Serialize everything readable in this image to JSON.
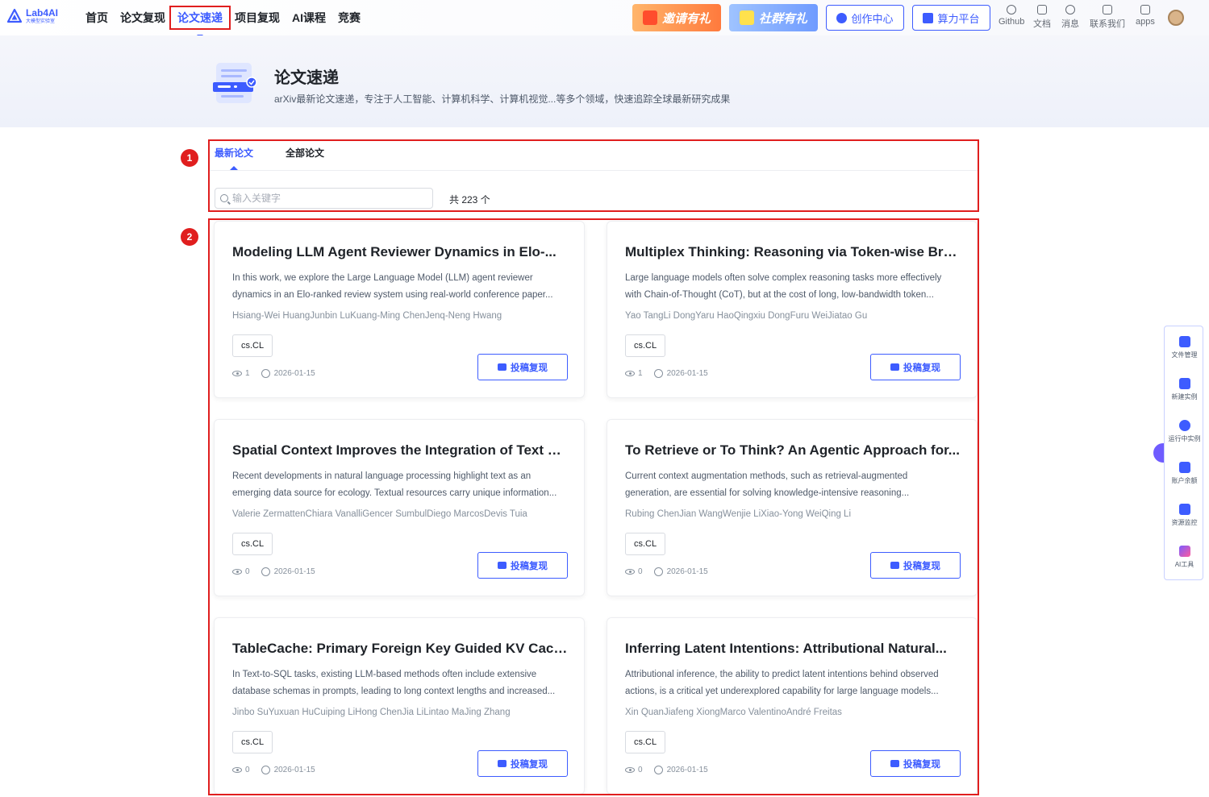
{
  "header": {
    "logo_title": "Lab4AI",
    "logo_subtitle": "大模型实验室",
    "nav": [
      {
        "label": "首页"
      },
      {
        "label": "论文复现"
      },
      {
        "label": "论文速递"
      },
      {
        "label": "项目复现"
      },
      {
        "label": "AI课程"
      },
      {
        "label": "竞赛"
      }
    ],
    "active_nav": "论文速递",
    "promo_invite": "邀请有礼",
    "promo_group": "社群有礼",
    "create_center": "创作中心",
    "compute_platform": "算力平台",
    "utils": [
      {
        "label": "Github",
        "icon": "github-icon"
      },
      {
        "label": "文档",
        "icon": "document-icon"
      },
      {
        "label": "消息",
        "icon": "bell-icon"
      },
      {
        "label": "联系我们",
        "icon": "chat-icon"
      },
      {
        "label": "apps",
        "icon": "apps-grid-icon"
      }
    ]
  },
  "hero": {
    "title": "论文速递",
    "description": "arXiv最新论文速递，专注于人工智能、计算机科学、计算机视觉...等多个领域，快速追踪全球最新研究成果"
  },
  "tabs": {
    "items": [
      {
        "label": "最新论文"
      },
      {
        "label": "全部论文"
      }
    ],
    "active": "最新论文"
  },
  "search": {
    "placeholder": "输入关键字",
    "value": ""
  },
  "total_label": "共 223 个",
  "markers": [
    "1",
    "2"
  ],
  "submit_label": "投稿复现",
  "papers": [
    {
      "title": "Modeling LLM Agent Reviewer Dynamics in Elo-...",
      "abstract": "In this work, we explore the Large Language Model (LLM) agent reviewer dynamics in an Elo-ranked review system using real-world conference paper...",
      "authors": "Hsiang-Wei HuangJunbin LuKuang-Ming ChenJenq-Neng Hwang",
      "tag": "cs.CL",
      "views": "1",
      "date": "2026-01-15"
    },
    {
      "title": "Multiplex Thinking: Reasoning via Token-wise Branc...",
      "abstract": "Large language models often solve complex reasoning tasks more effectively with Chain-of-Thought (CoT), but at the cost of long, low-bandwidth token...",
      "authors": "Yao TangLi DongYaru HaoQingxiu DongFuru WeiJiatao Gu",
      "tag": "cs.CL",
      "views": "1",
      "date": "2026-01-15"
    },
    {
      "title": "Spatial Context Improves the Integration of Text wit...",
      "abstract": "Recent developments in natural language processing highlight text as an emerging data source for ecology. Textual resources carry unique information...",
      "authors": "Valerie ZermattenChiara VanalliGencer SumbulDiego MarcosDevis Tuia",
      "tag": "cs.CL",
      "views": "0",
      "date": "2026-01-15"
    },
    {
      "title": "To Retrieve or To Think? An Agentic Approach for...",
      "abstract": "Current context augmentation methods, such as retrieval-augmented generation, are essential for solving knowledge-intensive reasoning...",
      "authors": "Rubing ChenJian WangWenjie LiXiao-Yong WeiQing Li",
      "tag": "cs.CL",
      "views": "0",
      "date": "2026-01-15"
    },
    {
      "title": "TableCache: Primary Foreign Key Guided KV Cache...",
      "abstract": "In Text-to-SQL tasks, existing LLM-based methods often include extensive database schemas in prompts, leading to long context lengths and increased...",
      "authors": "Jinbo SuYuxuan HuCuiping LiHong ChenJia LiLintao MaJing Zhang",
      "tag": "cs.CL",
      "views": "0",
      "date": "2026-01-15"
    },
    {
      "title": "Inferring Latent Intentions: Attributional Natural...",
      "abstract": "Attributional inference, the ability to predict latent intentions behind observed actions, is a critical yet underexplored capability for large language models...",
      "authors": "Xin QuanJiafeng XiongMarco ValentinoAndré Freitas",
      "tag": "cs.CL",
      "views": "0",
      "date": "2026-01-15"
    }
  ],
  "side_panel": [
    {
      "label": "文件管理",
      "icon": "folder-icon"
    },
    {
      "label": "新建实例",
      "icon": "add-instance-icon"
    },
    {
      "label": "运行中实例",
      "icon": "running-instance-icon"
    },
    {
      "label": "账户余额",
      "icon": "wallet-icon"
    },
    {
      "label": "资源监控",
      "icon": "chip-monitor-icon"
    },
    {
      "label": "AI工具",
      "icon": "ai-tool-icon"
    }
  ],
  "colors": {
    "brand": "#3d5cff",
    "annotation_red": "#e01e1e"
  }
}
